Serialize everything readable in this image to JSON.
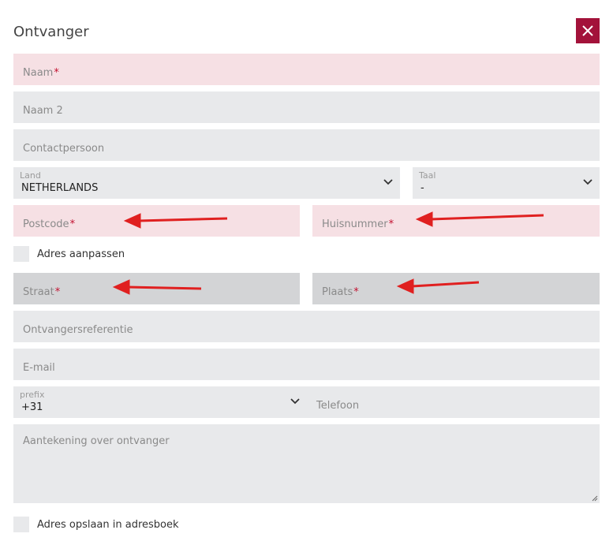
{
  "dialog": {
    "title": "Ontvanger"
  },
  "fields": {
    "naam": "Naam",
    "naam2": "Naam 2",
    "contactpersoon": "Contactpersoon",
    "land_label": "Land",
    "land_value": "NETHERLANDS",
    "taal_label": "Taal",
    "taal_value": "-",
    "postcode": "Postcode",
    "huisnummer": "Huisnummer",
    "adres_aanpassen": "Adres aanpassen",
    "straat": "Straat",
    "plaats": "Plaats",
    "ontvangersreferentie": "Ontvangersreferentie",
    "email": "E-mail",
    "prefix_label": "prefix",
    "prefix_value": "+31",
    "telefoon": "Telefoon",
    "aantekening": "Aantekening over ontvanger",
    "opslaan": "Adres opslaan in adresboek",
    "required_mark": "*"
  },
  "colors": {
    "accent": "#a3123a",
    "error_bg": "#f6e0e4",
    "arrow": "#e02020"
  }
}
